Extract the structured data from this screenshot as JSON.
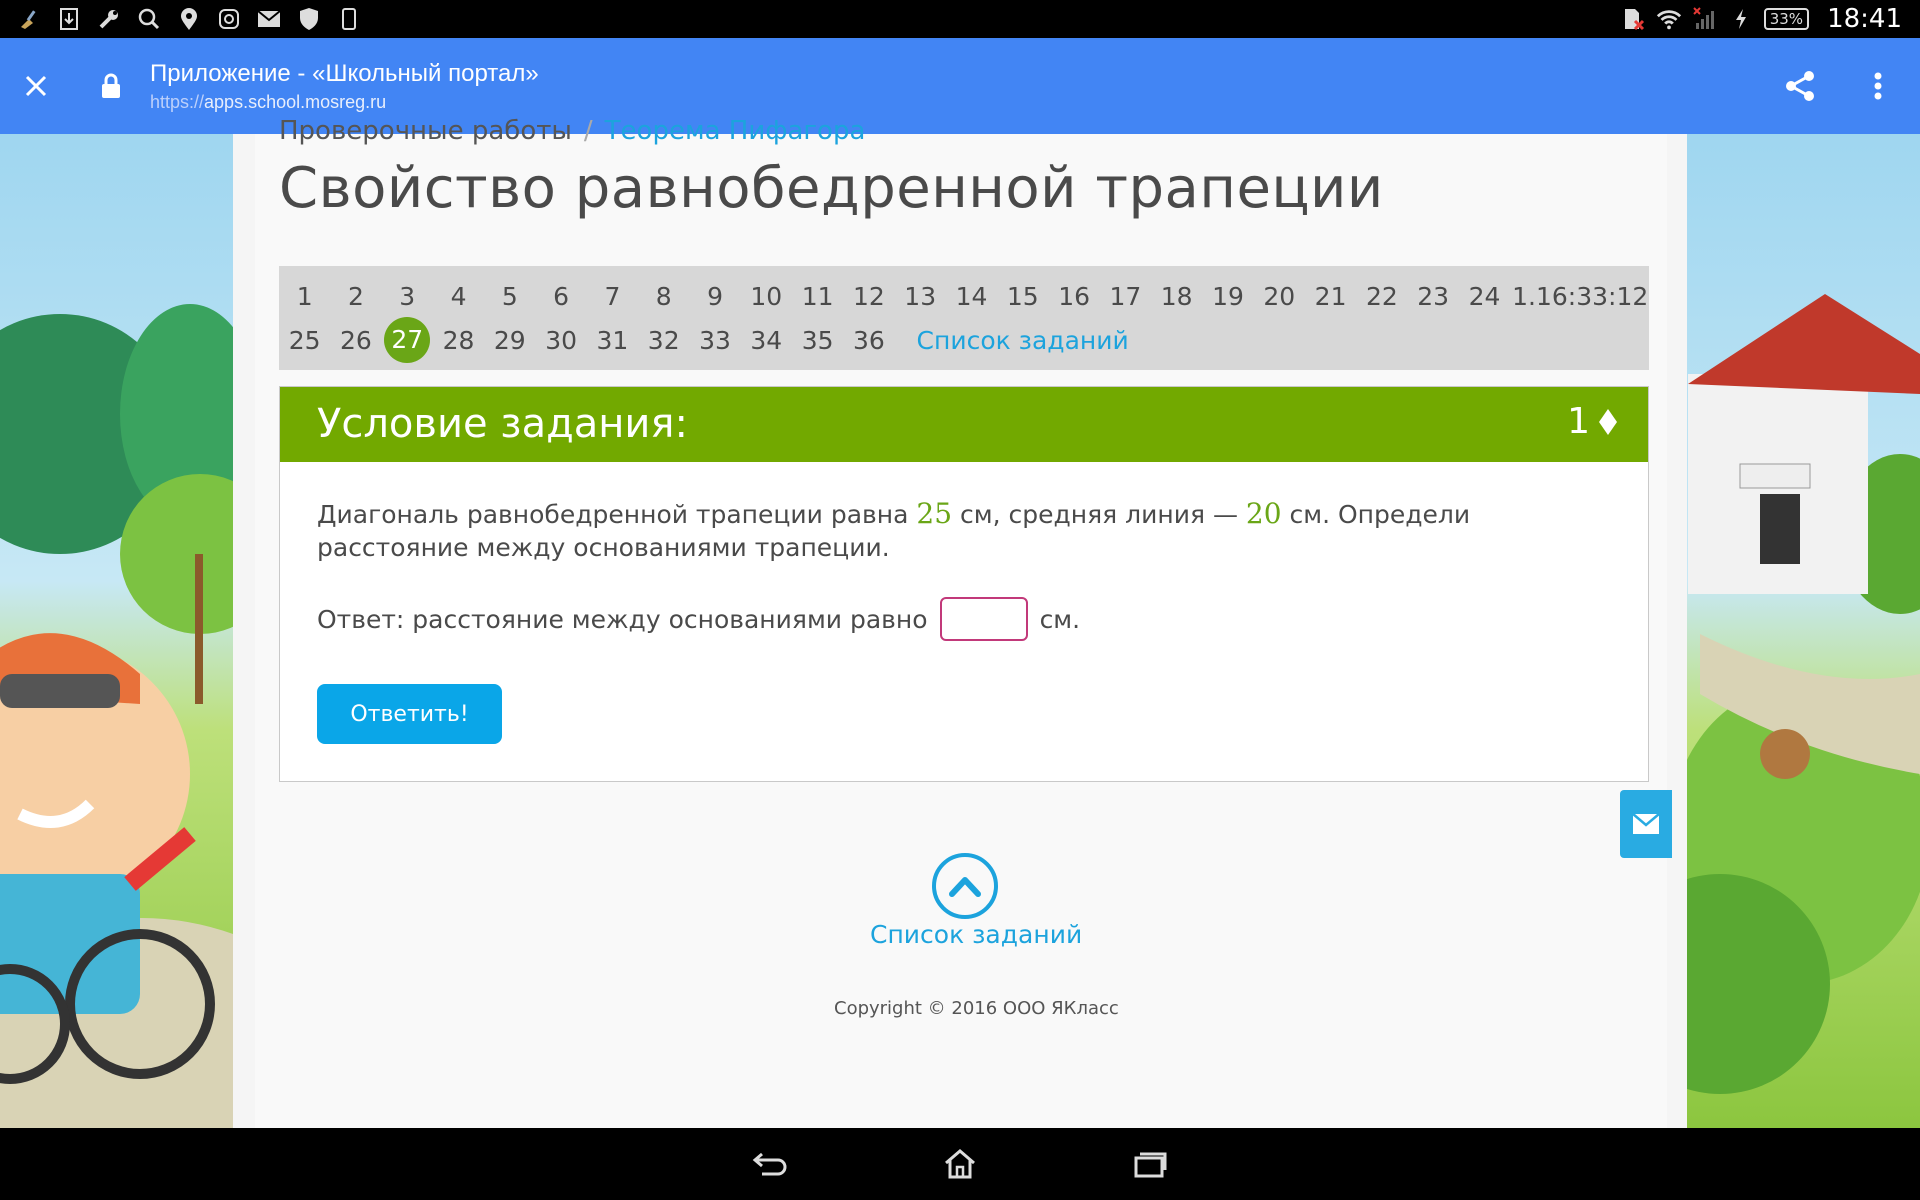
{
  "status_bar": {
    "left_icons": [
      "broom-icon",
      "download-icon",
      "wrench-icon",
      "search-icon",
      "location-pin-icon",
      "instagram-icon",
      "mail-icon",
      "shield-icon",
      "phone-icon"
    ],
    "right_icons": [
      "sd-card-off-icon",
      "wifi-icon",
      "signal-off-icon",
      "charging-icon"
    ],
    "battery": "33%",
    "time": "18:41"
  },
  "toolbar": {
    "title": "Приложение - «Школьный портал»",
    "url_scheme": "https://",
    "url_host": "apps.school.mosreg.ru",
    "bg_color": "#4285f4"
  },
  "breadcrumb": {
    "items": [
      "Проверочные работы",
      "Теорема Пифагора"
    ],
    "separator": "/"
  },
  "page": {
    "title": "Свойство равнобедренной трапеции"
  },
  "task_nav": {
    "row1": [
      "1",
      "2",
      "3",
      "4",
      "5",
      "6",
      "7",
      "8",
      "9",
      "10",
      "11",
      "12",
      "13",
      "14",
      "15",
      "16",
      "17",
      "18",
      "19",
      "20",
      "21",
      "22",
      "23",
      "24"
    ],
    "row2": [
      "25",
      "26",
      "27",
      "28",
      "29",
      "30",
      "31",
      "32",
      "33",
      "34",
      "35",
      "36"
    ],
    "active": "27",
    "timer": "1.16:33:12",
    "list_link": "Список заданий",
    "active_color": "#6aa617"
  },
  "task": {
    "header": "Условие задания:",
    "points": "1",
    "points_icon": "diamond-icon",
    "text_part1": "Диагональ равнобедренной трапеции равна ",
    "value1": "25",
    "text_part2": " см, средняя линия — ",
    "value2": "20",
    "text_part3": " см. Определи расстояние между основаниями трапеции.",
    "answer_label": "Ответ: расстояние между основаниями равно",
    "answer_value": "",
    "answer_unit": "см.",
    "submit_label": "Ответить!",
    "header_color": "#72a900",
    "submit_color": "#0aa6e8"
  },
  "footer": {
    "up_icon": "chevron-up-icon",
    "list_link": "Список заданий",
    "copyright": "Copyright © 2016 ООО ЯКласс"
  },
  "feedback_button": {
    "icon": "envelope-icon"
  },
  "nav_bar": {
    "buttons": [
      "back-icon",
      "home-icon",
      "recents-icon"
    ]
  }
}
